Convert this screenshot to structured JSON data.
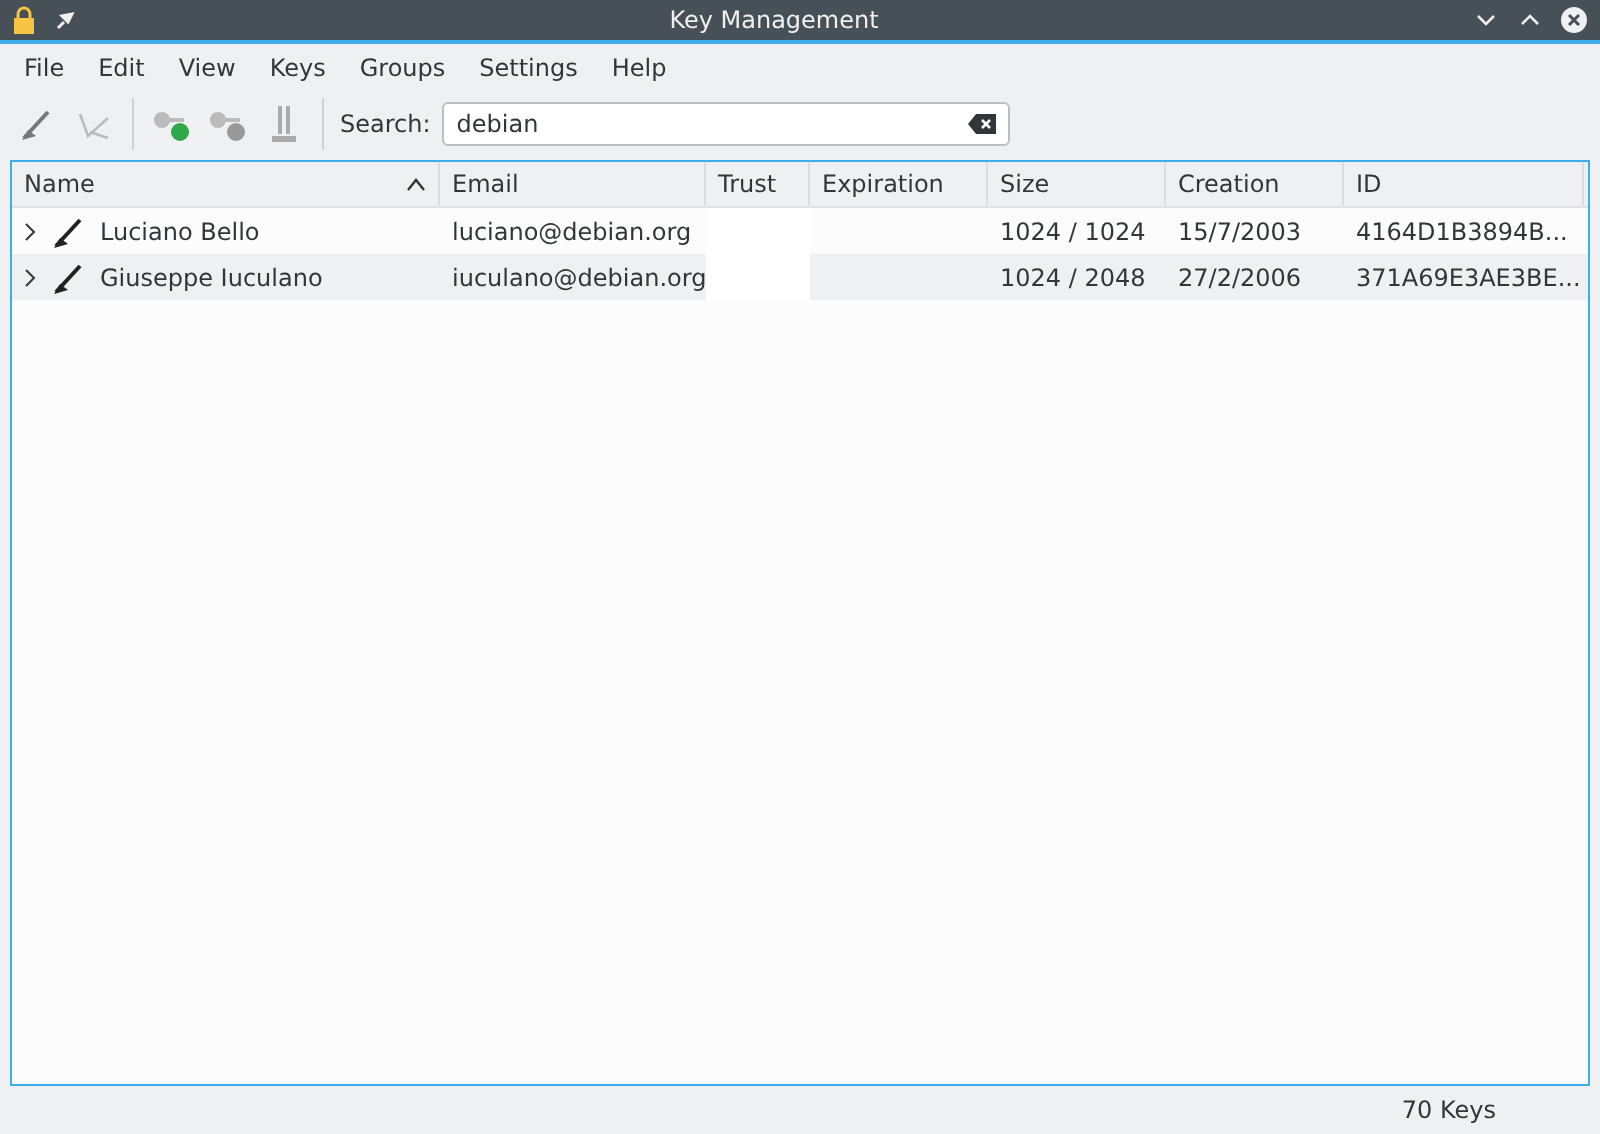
{
  "window": {
    "title": "Key Management"
  },
  "menu": [
    "File",
    "Edit",
    "View",
    "Keys",
    "Groups",
    "Settings",
    "Help"
  ],
  "search": {
    "label": "Search:",
    "value": "debian"
  },
  "table": {
    "columns": [
      {
        "label": "Name",
        "sorted": true
      },
      {
        "label": "Email",
        "sorted": false
      },
      {
        "label": "Trust",
        "sorted": false
      },
      {
        "label": "Expiration",
        "sorted": false
      },
      {
        "label": "Size",
        "sorted": false
      },
      {
        "label": "Creation",
        "sorted": false
      },
      {
        "label": "ID",
        "sorted": false
      }
    ],
    "rows": [
      {
        "expanded": false,
        "cells": [
          "Luciano Bello",
          "luciano@debian.org",
          "",
          "",
          "1024 / 1024",
          "15/7/2003",
          "4164D1B3894B..."
        ]
      },
      {
        "expanded": false,
        "cells": [
          "Giuseppe Iuculano",
          "iuculano@debian.org",
          "",
          "",
          "1024 / 2048",
          "27/2/2006",
          "371A69E3AE3BE..."
        ]
      }
    ]
  },
  "status_bar": {
    "count": "70 Keys"
  }
}
